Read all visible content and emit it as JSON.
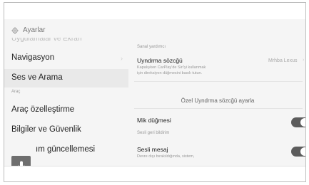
{
  "header": {
    "title": "Ayarlar",
    "icon": "gear-icon"
  },
  "sidebar": {
    "cut_item": "Uygulamalar ve Ekran",
    "items": [
      {
        "label": "Navigasyon"
      },
      {
        "label": "Ses ve Arama"
      },
      {
        "label": "Araç özelleştirme"
      },
      {
        "label": "Bilgiler ve Güvenlik"
      },
      {
        "label": "ım güncellemesi"
      }
    ],
    "category": "Araç",
    "mic_icon": "microphone-icon"
  },
  "main": {
    "section_assistant": "Sanal yardımcı",
    "wake_word": {
      "title": "Uyndrma sözcğü",
      "desc_line1": "Kapalıyken CarPlay'de Siri'yi kullanmak",
      "desc_line2": "için direksiyon düğmesini basılı tutun.",
      "value": "Mrhba Lexus"
    },
    "custom_wake_word": "Özel Uyndrma sözcğü ayarla",
    "mic_button": {
      "title": "Mik düğmesi",
      "on": true
    },
    "section_feedback": "Sesli geri bildirim",
    "voice_message": {
      "title": "Sesli mesaj",
      "desc": "Devre dışı bırakıldığında, sistem,",
      "on": true
    }
  }
}
